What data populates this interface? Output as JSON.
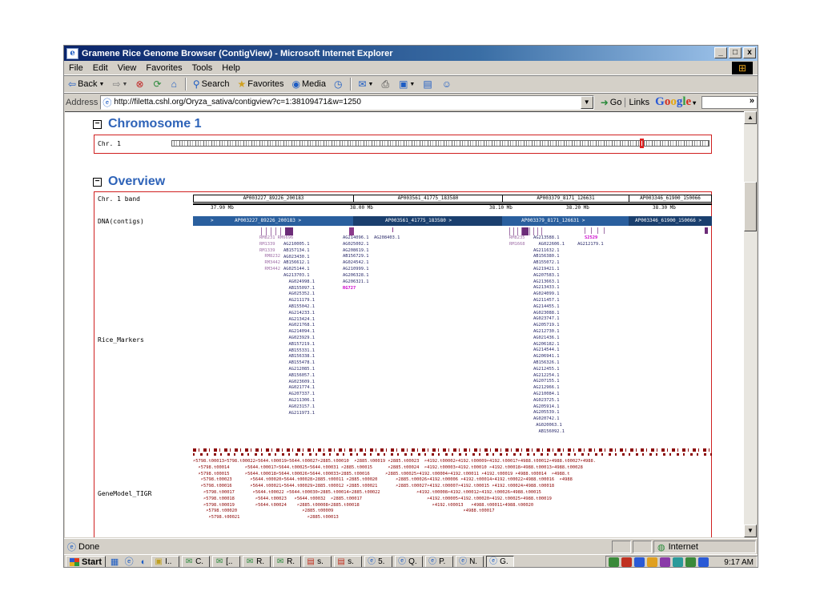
{
  "window": {
    "title": "Gramene Rice Genome Browser (ContigView) - Microsoft Internet Explorer",
    "minimize": "_",
    "maximize": "□",
    "close": "x"
  },
  "menu": [
    "File",
    "Edit",
    "View",
    "Favorites",
    "Tools",
    "Help"
  ],
  "toolbar": {
    "back": "Back",
    "search": "Search",
    "favorites": "Favorites",
    "media": "Media"
  },
  "address": {
    "label": "Address",
    "url": "http://filetta.cshl.org/Oryza_sativa/contigview?c=1:38109471&w=1250",
    "go": "Go",
    "links": "Links",
    "search_brand": "Google",
    "overflow": "»"
  },
  "chromosome": {
    "heading": "Chromosome 1",
    "row_label": "Chr. 1",
    "selection_fraction": 0.87
  },
  "overview": {
    "heading": "Overview",
    "band_label": "Chr. 1 band",
    "bands": [
      "AP003227_89226_200183",
      "AP003561_41775_183580",
      "AP003379_8171_126631",
      "AP003346_61900_150066"
    ],
    "scale": [
      "37.90 Mb",
      "38.00 Mb",
      "38.10 Mb",
      "38.20 Mb",
      "38.30 Mb"
    ],
    "dna_label": "DNA(contigs)",
    "contigs": [
      ">",
      "AP003227_89226_200183 >",
      "AP003561_41775_183580 >",
      "AP003379_8171_126631 >",
      "AP003346_61900_150066 >"
    ],
    "markers_label": "Rice_Markers",
    "markers": {
      "col1a": "RM8231 RM6696\nRM1339\nRM1339\n  RM8232\n  RM3442\n  RM3442",
      "col1b": "AG210005.1\nAB157134.1\nAG023430.1\nAB156612.1\nAG025144.1\nAG213703.1\n  AG024998.1\n  AB155097.1\n  AG025352.1\n  AG211179.1\n  AB155042.1\n  AG214233.1\n  AG213424.1\n  AG021768.1\n  AG214094.1\n  AG023929.1\n  AB157219.1\n  AB155331.1\n  AB156338.1\n  AB155478.1\n  AG212085.1\n  AB156057.1\n  AG023609.1\n  AG021774.1\n  AG207337.1\n  AG211306.1\n  AG023157.1\n  AG211973.1",
      "col2": "AG214096.1  AG208403.1\nAG025002.1\nAG208619.1\nAB156729.1\nAG024542.1\nAG210999.1\nAG206328.1\nAG206321.1",
      "col2_highlight": "RG727",
      "col3a": "RM8235\nRM1668",
      "col3b": "AG213588.1\n  AG022606.1     AG212179.1\nAG211632.1\nAB156380.1\nAB155072.1\nAG219421.1\nAG207583.1\nAG213663.1\nAG213433.1\nAG024099.1\nAG211457.1\nAG214455.1\nAG023088.1\nAG023747.1\nAG205719.1\nAG212730.1\nAG021436.1\nAG206182.1\nAG214544.1\nAG206941.1\nAB156326.1\nAG212455.1\nAG212254.1\nAG207155.1\nAG212966.1\nAG210084.1\nAG023725.1\nAG205914.1\nAG205539.1\nAG020742.1\n AG020063.1\n  AB156092.1",
      "col3_highlight": "S2529"
    },
    "gene_label": "GeneModel_TIGR",
    "genes": {
      "g1": "⌕5798.t00013⌕5798.t00022⌕5644.t00019⌕5644.t00027⌕2885.t00010  ⌕2885.t00019 ⌕2885.t00023  ⌕4192.t00002⌕4192.t00009⌕4192.t00017⌕4988.t00012⌕4988.t00027⌕4988.\n  ⌕5798.t00014      ⌕5644.t00017⌕5644.t00025⌕5644.t00031 ⌕2885.t00015      ⌕2885.t00024  ⌕4192.t00003⌕4192.t00010 ⌕4192.t00018⌕4988.t00013⌕4988.t00028\n  ⌕5798.t00015      ⌕5644.t00018⌕5644.t00026⌕5644.t00033⌕2885.t00016      ⌕2885.t00025⌕4192.t00004⌕4192.t00011 ⌕4192.t00019 ⌕4988.t00014  ⌕4988.t\n   ⌕5798.t00023       ⌕5644.t00020⌕5644.t00028⌕2885.t00011 ⌕2885.t00020       ⌕2885.t00026⌕4192.t00006 ⌕4192.t00014⌕4192.t00022⌕4988.t00016  ⌕4988\n   ⌕5798.t00016       ⌕5644.t00021⌕5644.t00029⌕2885.t00012 ⌕2885.t00021       ⌕2885.t00027⌕4192.t00007⌕4192.t00015 ⌕4192.t00024⌕4988.t00018\n    ⌕5798.t00017       ⌕5644.t00022 ⌕5644.t00030⌕2885.t00014⌕2885.t00022              ⌕4192.t00008⌕4192.t00012⌕4192.t00026⌕4988.t00015\n    ⌕5798.t00018        ⌕5644.t00023   ⌕5644.t00032  ⌕2885.t00017                         ⌕4192.t00005⌕4192.t00020⌕4192.t00025⌕4988.t00019\n    ⌕5798.t00019        ⌕5644.t00024    ⌕2885.t00008⌕2885.t00018                            ⌕4192.t00013   ⌕4988.t00011⌕4988.t00020\n     ⌕5798.t00020                         ⌕2885.t00009                                                  ⌕4988.t00017\n      ⌕5798.t00021                          ⌕2885.t00013"
    }
  },
  "status": {
    "done": "Done",
    "zone": "Internet"
  },
  "taskbar": {
    "start": "Start",
    "tasks": [
      "I..",
      "C.",
      "[..",
      "R.",
      "R.",
      "s.",
      "s.",
      "5.",
      "Q.",
      "P.",
      "N.",
      "G."
    ],
    "clock": "9:17 AM"
  }
}
